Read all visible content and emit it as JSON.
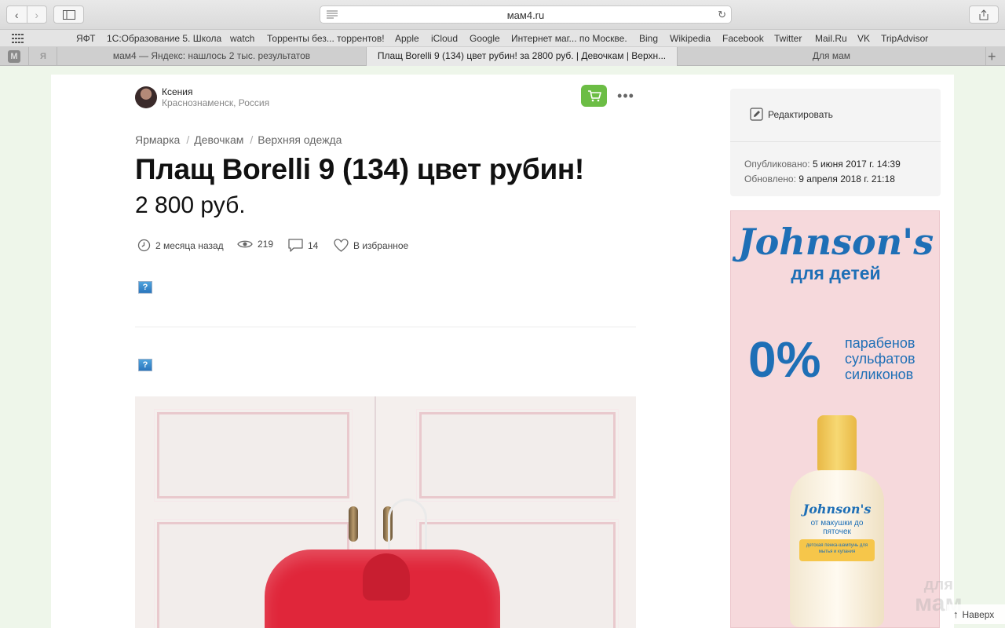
{
  "browser": {
    "url": "мам4.ru",
    "bookmarks": [
      "ЯФТ",
      "1С:Образование 5. Школа",
      "watch",
      "Торренты без... торрентов!",
      "Apple",
      "iCloud",
      "Google",
      "Интернет маг... по Москве.",
      "Bing",
      "Wikipedia",
      "Facebook",
      "Twitter",
      "Mail.Ru",
      "VK",
      "TripAdvisor"
    ],
    "pinned_tabs": [
      "M",
      "Я"
    ],
    "tabs": [
      {
        "label": "мам4 — Яндекс: нашлось 2 тыс. результатов",
        "active": false
      },
      {
        "label": "Плащ Borelli 9 (134) цвет рубин! за 2800 руб. | Девочкам | Верхн...",
        "active": true
      },
      {
        "label": "Для мам",
        "active": false
      }
    ]
  },
  "author": {
    "name": "Ксения",
    "city": "Краснознаменск, Россия"
  },
  "breadcrumbs": [
    "Ярмарка",
    "Девочкам",
    "Верхняя одежда"
  ],
  "breadcrumb_sep": "/",
  "listing": {
    "title": "Плащ Borelli 9 (134) цвет рубин!",
    "price": "2 800 руб."
  },
  "stats": {
    "age": "2 месяца назад",
    "views": "219",
    "comments": "14",
    "favorite": "В избранное"
  },
  "placeholder_icon": "?",
  "sidebar": {
    "edit_label": "Редактировать",
    "published_label": "Опубликовано:",
    "published_value": "5 июня 2017 г. 14:39",
    "updated_label": "Обновлено:",
    "updated_value": "9 апреля 2018 г. 21:18"
  },
  "ad": {
    "brand": "Johnson's",
    "sub": "для детей",
    "percent": "0%",
    "items": [
      "парабенов",
      "сульфатов",
      "силиконов"
    ],
    "bottle_brand": "Johnson's",
    "bottle_line": "от макушки до пяточек",
    "bottle_desc": "детская пенка-шампунь для мытья и купания"
  },
  "watermark": {
    "top": "для",
    "bottom": "мам"
  },
  "to_top": "Наверх",
  "colors": {
    "cart_green": "#6cbd45",
    "ad_blue": "#1e6fb6",
    "ad_bg": "#f6d9dc",
    "page_bg": "#eef6ea"
  }
}
